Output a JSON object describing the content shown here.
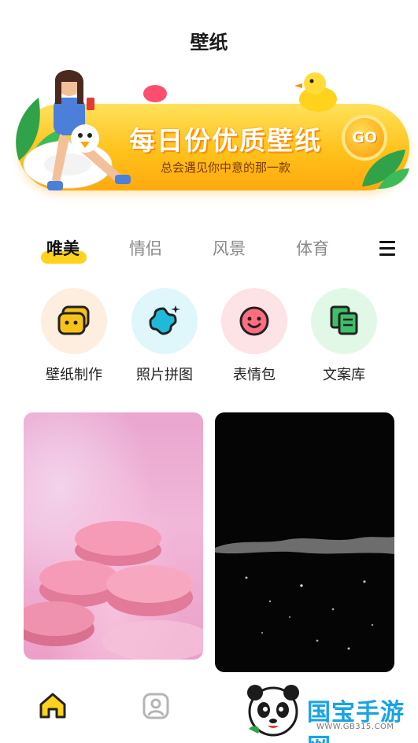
{
  "header": {
    "title": "壁纸"
  },
  "banner": {
    "title": "每日份优质壁纸",
    "subtitle": "总会遇见你中意的那一款",
    "go_label": "GO"
  },
  "tabs": [
    {
      "label": "唯美",
      "active": true
    },
    {
      "label": "情侣",
      "active": false
    },
    {
      "label": "风景",
      "active": false
    },
    {
      "label": "体育",
      "active": false
    }
  ],
  "tools": [
    {
      "label": "壁纸制作",
      "icon": "wallpaper-make-icon",
      "bg": "#fdeee0"
    },
    {
      "label": "照片拼图",
      "icon": "sparkle-puzzle-icon",
      "bg": "#dff6fb"
    },
    {
      "label": "表情包",
      "icon": "smiley-icon",
      "bg": "#fde3e6"
    },
    {
      "label": "文案库",
      "icon": "copy-library-icon",
      "bg": "#e2f8e6"
    }
  ],
  "cards": [
    {
      "name": "macaron-wallpaper"
    },
    {
      "name": "dark-water-wallpaper"
    }
  ],
  "bottom_nav": [
    {
      "icon": "home-icon",
      "active": true
    },
    {
      "icon": "profile-icon",
      "active": false
    }
  ],
  "watermark": {
    "text": "国宝手游网",
    "url": "WWW.GB315.COM"
  },
  "colors": {
    "accent": "#ffd21c",
    "icon_dark": "#222222"
  }
}
